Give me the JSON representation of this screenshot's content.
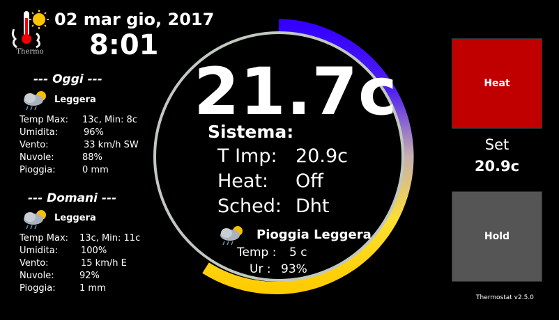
{
  "header": {
    "logo_text": "Thermo",
    "date": "02 mar gio, 2017",
    "time": "8:01"
  },
  "today": {
    "title": "--- Oggi ---",
    "icon": "cloud-rain-sun-icon",
    "condition": "Leggera",
    "rows": [
      {
        "label": "Temp Max:",
        "value": "13c, Min: 8c"
      },
      {
        "label": "Umidita:",
        "value": "96%"
      },
      {
        "label": "Vento:",
        "value": "33 km/h SW"
      },
      {
        "label": "Nuvole:",
        "value": "88%"
      },
      {
        "label": "Pioggia:",
        "value": "0 mm"
      }
    ]
  },
  "tomorrow": {
    "title": "--- Domani ---",
    "icon": "cloud-rain-sun-icon",
    "condition": "Leggera",
    "rows": [
      {
        "label": "Temp Max:",
        "value": "13c, Min: 11c"
      },
      {
        "label": "Umidita:",
        "value": "100%"
      },
      {
        "label": "Vento:",
        "value": "15 km/h E"
      },
      {
        "label": "Nuvole:",
        "value": "92%"
      },
      {
        "label": "Pioggia:",
        "value": "1 mm"
      }
    ]
  },
  "dial": {
    "current_temp": "21.7c",
    "system_title": "Sistema:",
    "system": [
      {
        "label": "T Imp:",
        "value": "20.9c"
      },
      {
        "label": "Heat:",
        "value": "Off"
      },
      {
        "label": "Sched:",
        "value": "Dht"
      }
    ],
    "forecast_icon": "cloud-rain-sun-icon",
    "forecast_condition": "Pioggia Leggera",
    "forecast_temp_label": "Temp :",
    "forecast_temp_value": "5 c",
    "forecast_hum_label": "Ur :",
    "forecast_hum_value": "93%"
  },
  "controls": {
    "heat_label": "Heat",
    "set_label": "Set",
    "set_value": "20.9c",
    "hold_label": "Hold",
    "version": "Thermostat v2.5.0"
  },
  "colors": {
    "heat_button": "#c00000",
    "hold_button": "#555555",
    "gauge_start": "#3300ff",
    "gauge_end": "#ffcc00",
    "dial_ring": "#c0c8c0"
  }
}
